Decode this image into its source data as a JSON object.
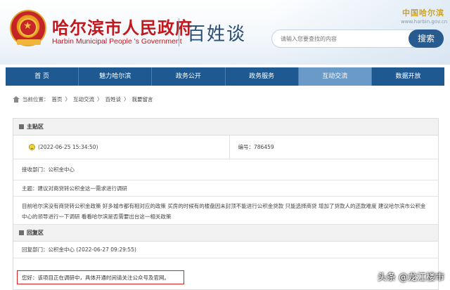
{
  "header": {
    "title_cn": "哈尔滨市人民政府",
    "title_en": "Harbin Municipal People 's Government",
    "subtitle": "百姓谈",
    "brand_badge": "中国哈尔滨",
    "brand_url": "www.harbin.gov.cn",
    "search_placeholder": "请输入您要查找的内容",
    "search_button": "搜索"
  },
  "nav": {
    "items": [
      {
        "label": "首 页"
      },
      {
        "label": "魅力哈尔滨"
      },
      {
        "label": "政务公开"
      },
      {
        "label": "政务服务"
      },
      {
        "label": "互动交流"
      },
      {
        "label": "数据开放"
      }
    ],
    "active_index": 4
  },
  "breadcrumb": {
    "prefix": "当前位置：",
    "items": [
      "首页",
      "互动交流",
      "百姓谈",
      "我要留言"
    ],
    "sep": "〉"
  },
  "post": {
    "section_title": "主贴区",
    "time": "(2022-06-25 15:34:50)",
    "number": "编号：786459",
    "dept": "接收部门：公积金中心",
    "topic": "主题：建议对商贷转公积金这一需求进行调研",
    "body": "目前哈尔滨没有商贷转公积金政策 好多城市都有相对应的政策 买房的时候有的楼盘因未封顶不能进行公积金贷款 只能选择商贷 增加了贷款人的还款难度 建议哈尔滨市公积金中心的领导进行一下调研 看看哈尔滨是否需要出台这一相关政策"
  },
  "reply": {
    "section_title": "回复区",
    "dept_time": "回复部门：公积金中心 (2022-06-27 09:29:55)",
    "content": "您好：该项目正在调研中，具体开通时间请关注公众号及官网。"
  },
  "watermark": {
    "text": "头条 @龙江楼市"
  },
  "colors": {
    "brand_red": "#c0181d",
    "nav_blue": "#1e5a91",
    "nav_active": "#6a9bc8",
    "highlight_red": "#e02020"
  }
}
